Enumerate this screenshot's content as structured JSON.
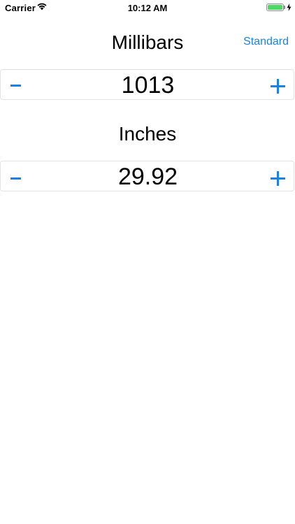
{
  "status_bar": {
    "carrier": "Carrier",
    "time": "10:12 AM",
    "battery_level": 1.0,
    "charging": true,
    "icons": [
      "wifi-icon",
      "battery-icon",
      "charging-bolt-icon"
    ]
  },
  "millibars": {
    "title": "Millibars",
    "value": "1013"
  },
  "inches": {
    "title": "Inches",
    "value": "29.92"
  },
  "nav": {
    "standard_label": "Standard"
  },
  "colors": {
    "accent": "#1a82e2",
    "battery": "#4cd964"
  }
}
